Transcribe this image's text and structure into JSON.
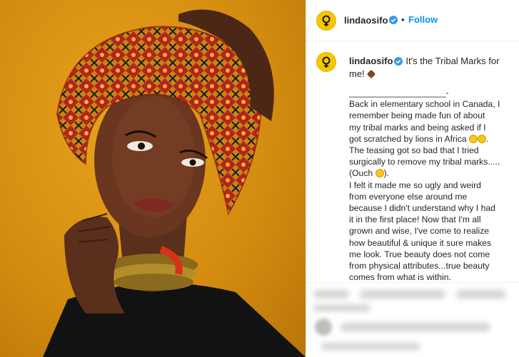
{
  "post": {
    "username": "lindaosifo",
    "follow_label": "Follow",
    "separator": "•",
    "caption_title": "It's the Tribal Marks for me!",
    "caption_lines": [
      "____________________-",
      "Back in elementary school in Canada, I",
      "remember being made fun of about",
      "my tribal marks and being asked if I",
      "got scratched by lions in Africa",
      "The teasing got so bad that I tried",
      "surgically to remove my tribal marks.....",
      "(Ouch",
      "I felt it made me so ugly and weird",
      "from everyone else around me",
      "because I didn't understand why I had",
      "it in the first place! Now that I'm all",
      "grown and wise, I've come to realize",
      "how beautiful & unique it sure makes",
      "me look. True beauty does not come",
      "from physical attributes...true beauty",
      "comes from what is within."
    ]
  },
  "icons": {
    "verified": "verified-badge-icon",
    "avatar": "female-symbol-avatar",
    "emoji_laugh": "rolling-laughing-emoji",
    "emoji_sad": "sad-emoji",
    "emoji_heart": "brown-heart-emoji"
  },
  "colors": {
    "follow": "#0095f6",
    "verified": "#3897f0",
    "avatar_bg": "#f6c700",
    "photo_bg": "#d58d10"
  }
}
